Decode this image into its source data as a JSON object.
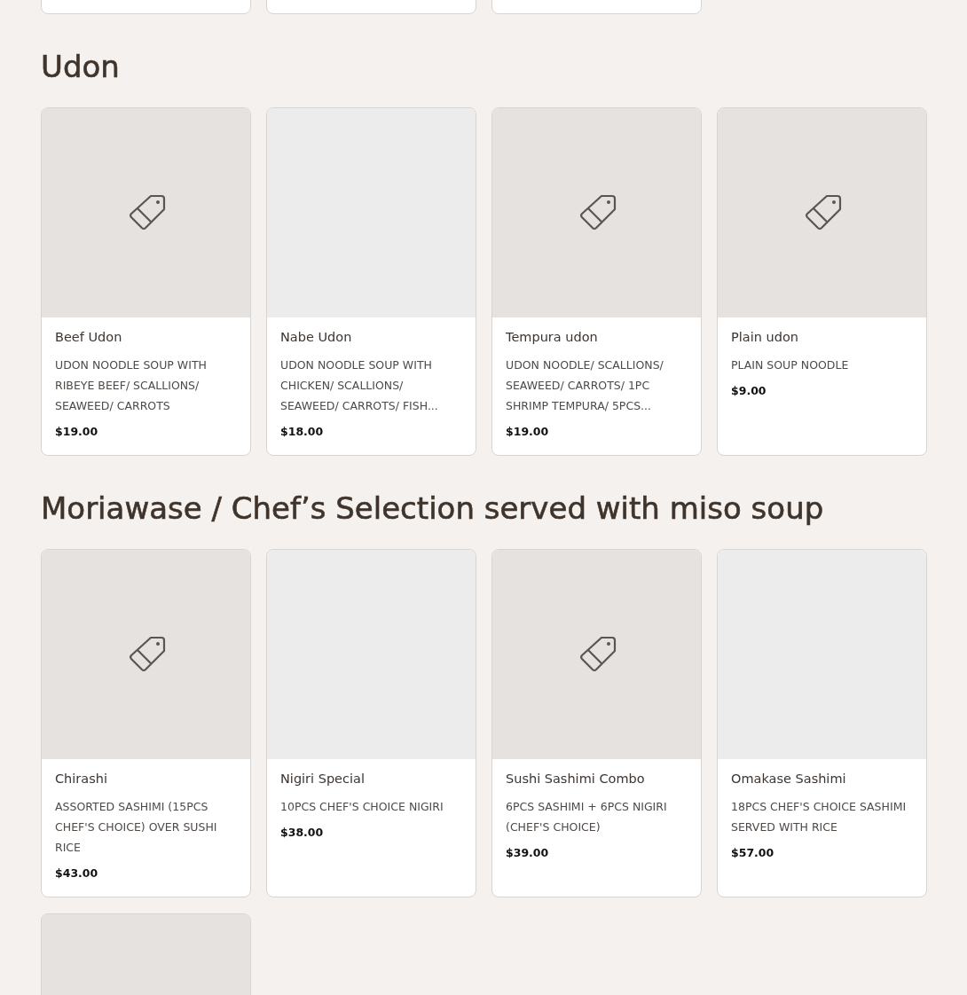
{
  "previous_section": {
    "cards": [
      {
        "kind": "cut_off"
      },
      {
        "kind": "cut_off"
      },
      {
        "kind": "cut_off"
      }
    ]
  },
  "sections": [
    {
      "title": "Udon",
      "items": [
        {
          "name": "Beef Udon",
          "description": "UDON NOODLE SOUP WITH RIBEYE BEEF/ SCALLIONS/ SEAWEED/ CARROTS",
          "price": "$19.00",
          "kind": "tagged"
        },
        {
          "name": "Nabe Udon",
          "description": "UDON NOODLE SOUP WITH CHICKEN/ SCALLIONS/ SEAWEED/ CARROTS/ FISH...",
          "price": "$18.00",
          "kind": "plain"
        },
        {
          "name": "Tempura udon",
          "description": "UDON NOODLE/ SCALLIONS/ SEAWEED/ CARROTS/ 1PC SHRIMP TEMPURA/ 5PCS...",
          "price": "$19.00",
          "kind": "tagged"
        },
        {
          "name": "Plain udon",
          "description": "PLAIN SOUP NOODLE",
          "price": "$9.00",
          "kind": "tagged"
        }
      ]
    },
    {
      "title": "Moriawase / Chef’s Selection served with miso soup",
      "items": [
        {
          "name": "Chirashi",
          "description": "ASSORTED SASHIMI (15PCS CHEF'S CHOICE) OVER SUSHI RICE",
          "price": "$43.00",
          "kind": "tagged"
        },
        {
          "name": "Nigiri Special",
          "description": "10PCS CHEF'S CHOICE NIGIRI",
          "price": "$38.00",
          "kind": "plain"
        },
        {
          "name": "Sushi Sashimi Combo",
          "description": "6PCS SASHIMI + 6PCS NIGIRI (CHEF'S CHOICE)",
          "price": "$39.00",
          "kind": "tagged"
        },
        {
          "name": "Omakase Sashimi",
          "description": "18PCS CHEF'S CHOICE SASHIMI SERVED WITH RICE",
          "price": "$57.00",
          "kind": "plain"
        },
        {
          "kind": "cut_off"
        }
      ]
    }
  ]
}
